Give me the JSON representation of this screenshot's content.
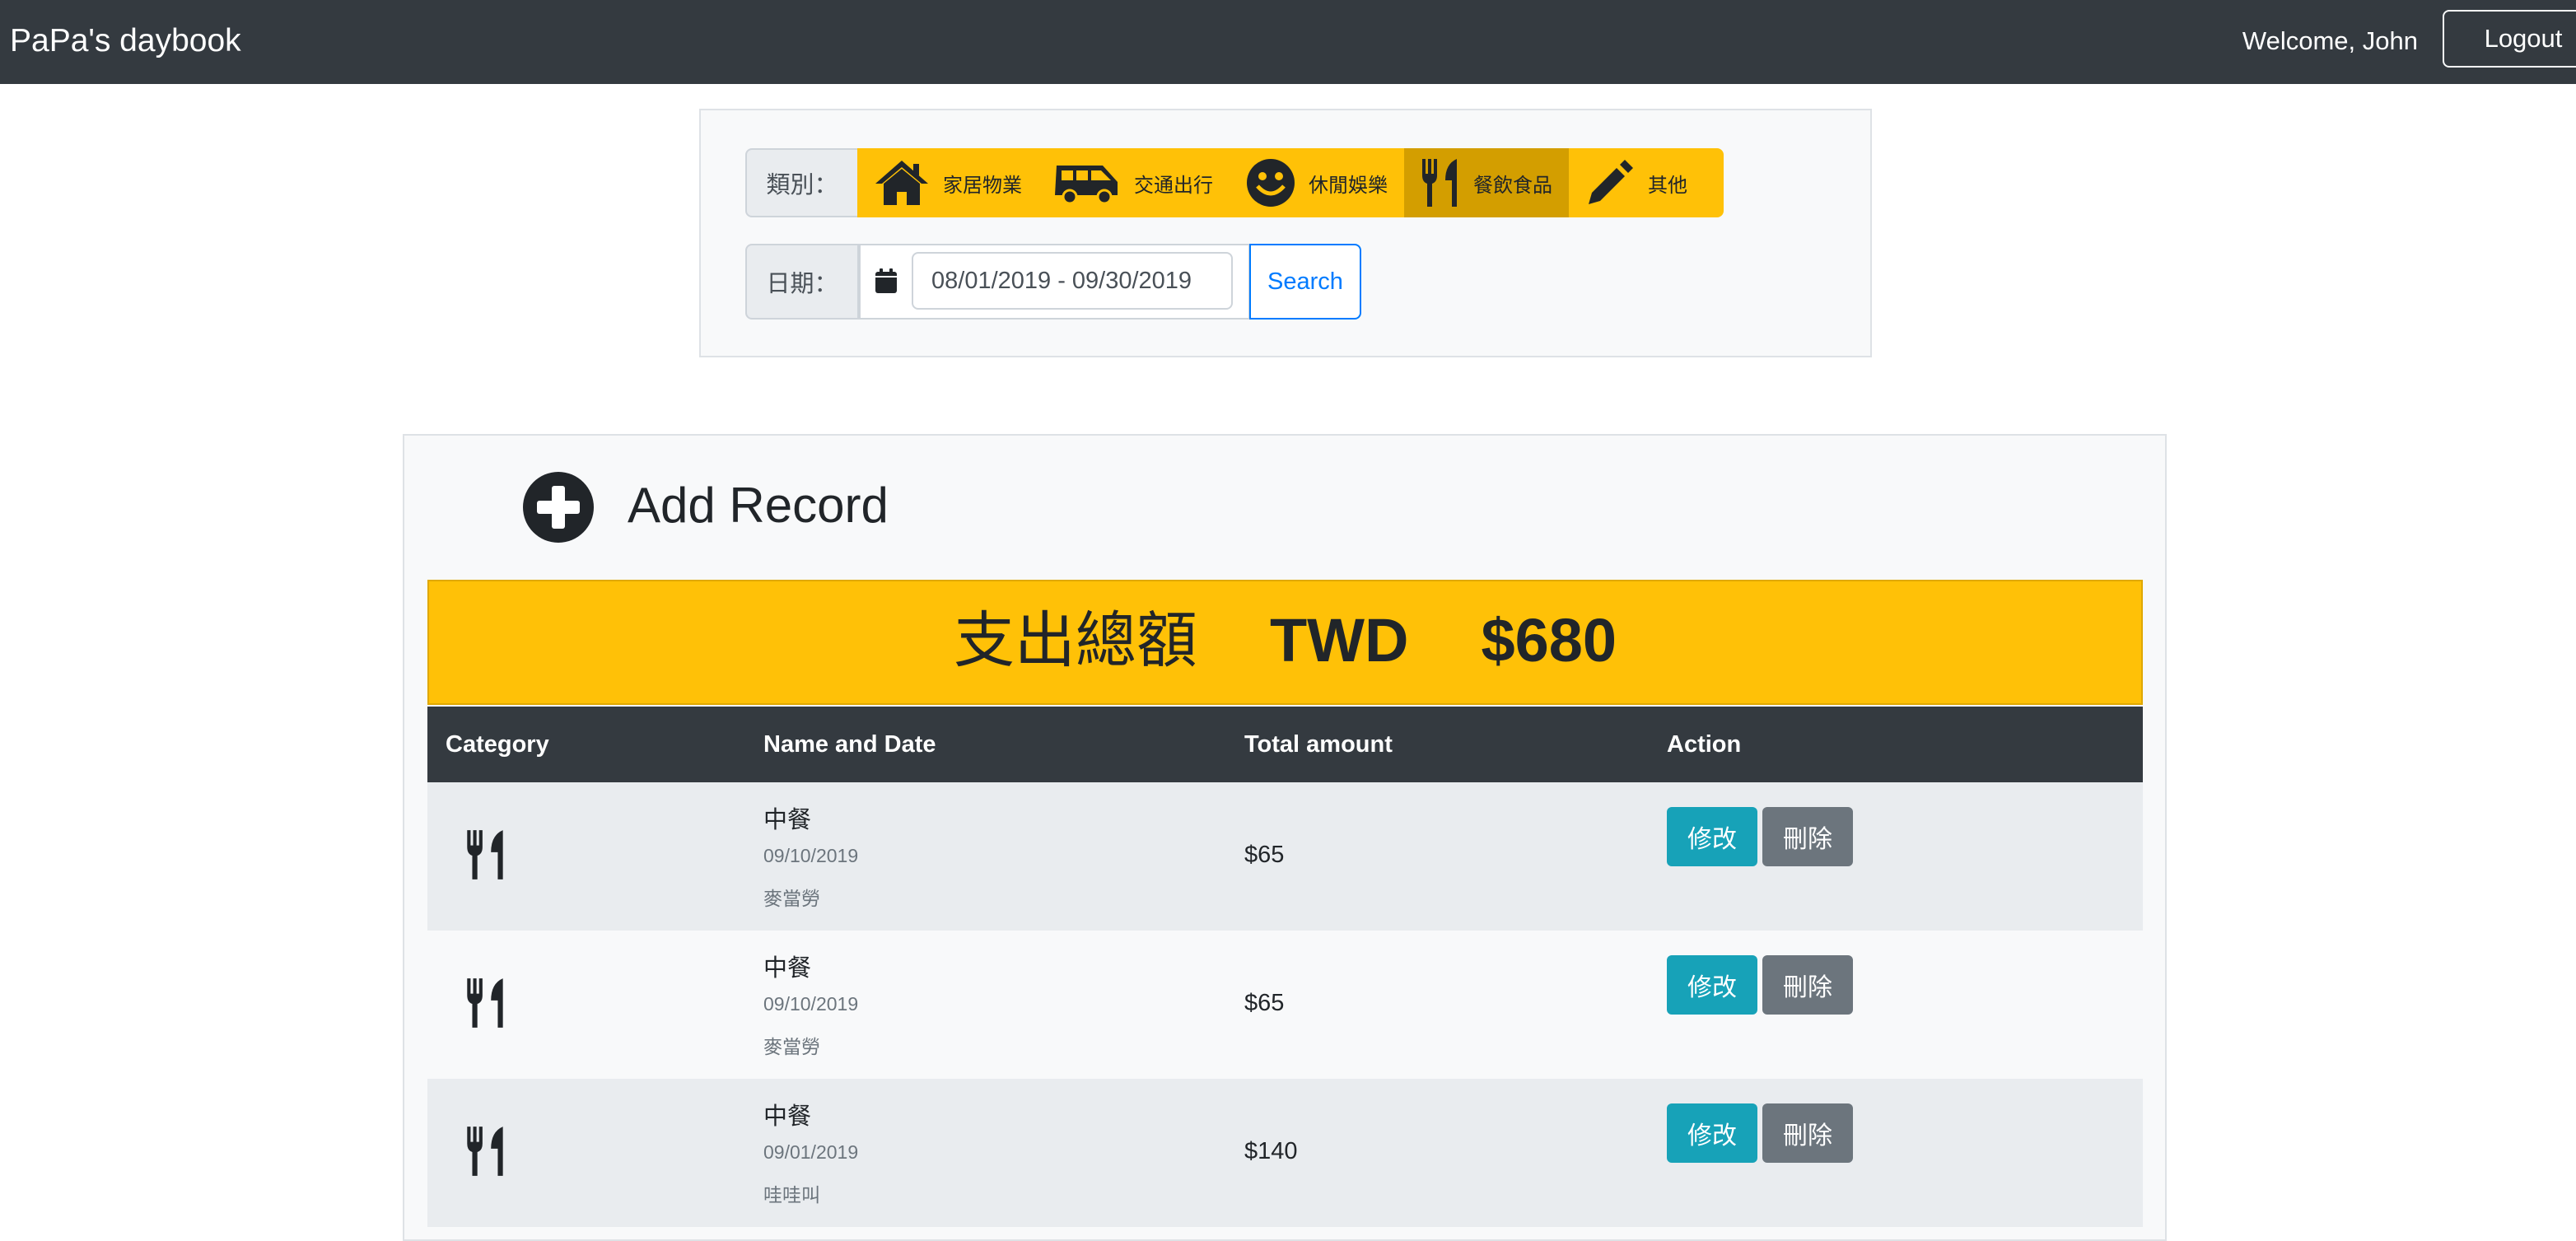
{
  "navbar": {
    "brand": "PaPa's daybook",
    "welcome": "Welcome, John",
    "logout_label": "Logout"
  },
  "filter": {
    "category_label": "類別：",
    "categories": [
      {
        "label": "家居物業",
        "icon": "home-icon",
        "active": false
      },
      {
        "label": "交通出行",
        "icon": "shuttle-van-icon",
        "active": false
      },
      {
        "label": "休閒娛樂",
        "icon": "smile-icon",
        "active": false
      },
      {
        "label": "餐飲食品",
        "icon": "utensils-icon",
        "active": true
      },
      {
        "label": "其他",
        "icon": "pen-icon",
        "active": false
      }
    ],
    "date_label": "日期：",
    "date_value": "08/01/2019 - 09/30/2019",
    "search_label": "Search"
  },
  "main": {
    "add_title": "Add Record",
    "total": {
      "label": "支出總額",
      "currency": "TWD",
      "amount": "$680"
    },
    "table": {
      "headers": [
        "Category",
        "Name and Date",
        "Total amount",
        "Action"
      ],
      "rows": [
        {
          "icon": "utensils-icon",
          "name": "中餐",
          "date": "09/10/2019",
          "merchant": "麥當勞",
          "amount": "$65",
          "edit": "修改",
          "delete": "刪除"
        },
        {
          "icon": "utensils-icon",
          "name": "中餐",
          "date": "09/10/2019",
          "merchant": "麥當勞",
          "amount": "$65",
          "edit": "修改",
          "delete": "刪除"
        },
        {
          "icon": "utensils-icon",
          "name": "中餐",
          "date": "09/01/2019",
          "merchant": "哇哇叫",
          "amount": "$140",
          "edit": "修改",
          "delete": "刪除"
        }
      ]
    }
  },
  "colors": {
    "navbar": "#343a40",
    "warning": "#ffc107",
    "warning_active": "#d39e00",
    "info": "#17a2b8",
    "secondary": "#6c757d",
    "primary": "#007bff"
  }
}
